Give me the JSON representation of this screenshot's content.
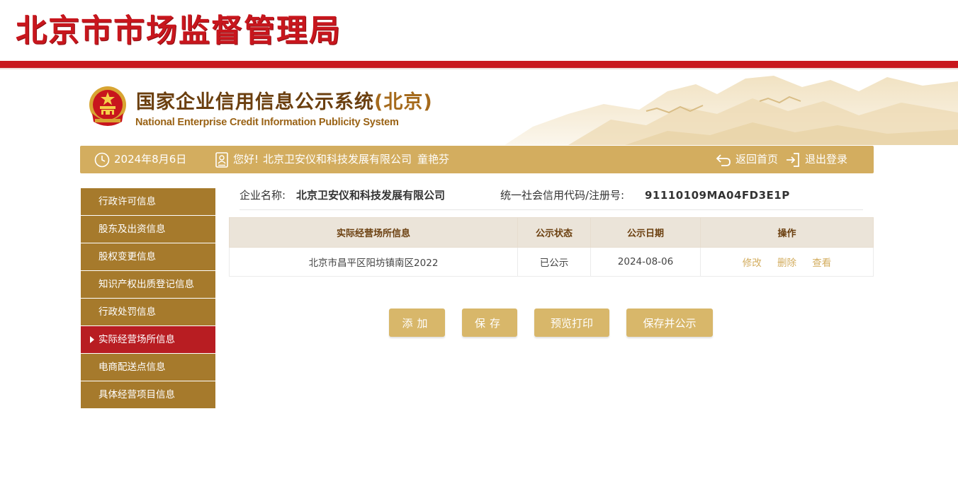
{
  "agency": {
    "title": "北京市市场监督管理局"
  },
  "banner": {
    "title_main": "国家企业信用信息公示系统",
    "title_city": "(北京)",
    "subtitle": "National Enterprise Credit Information Publicity System"
  },
  "info_bar": {
    "date": "2024年8月6日",
    "greeting": "您好!",
    "company": "北京卫安仪和科技发展有限公司",
    "user_name": "童艳芬",
    "home_label": "返回首页",
    "logout_label": "退出登录"
  },
  "sidebar": {
    "items": [
      {
        "label": "行政许可信息"
      },
      {
        "label": "股东及出资信息"
      },
      {
        "label": "股权变更信息"
      },
      {
        "label": "知识产权出质登记信息"
      },
      {
        "label": "行政处罚信息"
      },
      {
        "label": "实际经营场所信息",
        "active": true
      },
      {
        "label": "电商配送点信息"
      },
      {
        "label": "具体经营项目信息"
      }
    ]
  },
  "company": {
    "name_label": "企业名称:",
    "name": "北京卫安仪和科技发展有限公司",
    "code_label": "统一社会信用代码/注册号:",
    "code": "91110109MA04FD3E1P"
  },
  "table": {
    "headers": [
      "实际经营场所信息",
      "公示状态",
      "公示日期",
      "操作"
    ],
    "rows": [
      {
        "address": "北京市昌平区阳坊镇南区2022",
        "status": "已公示",
        "date": "2024-08-06",
        "actions": [
          "修改",
          "删除",
          "查看"
        ]
      }
    ]
  },
  "buttons": {
    "add": "添加",
    "save": "保存",
    "preview": "预览打印",
    "save_publish": "保存并公示"
  },
  "colors": {
    "brand_red": "#c8161d",
    "gold": "#d3ad5f",
    "sidebar_brown": "#a67a2c",
    "active_red": "#b81d22"
  }
}
